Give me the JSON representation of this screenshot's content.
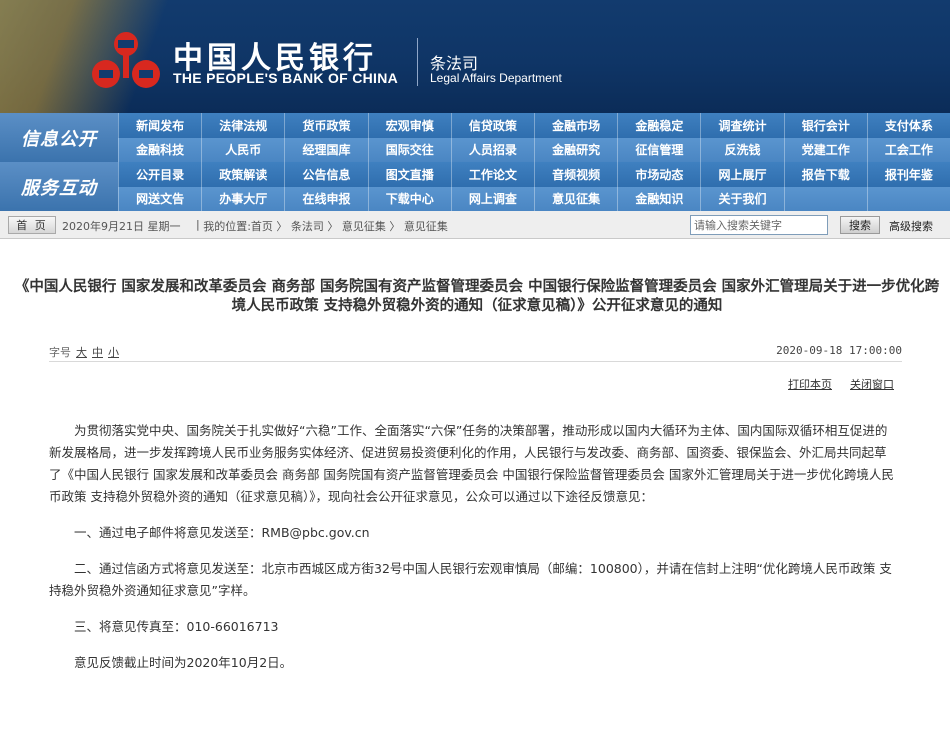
{
  "header": {
    "brand_cn": "中国人民银行",
    "brand_en": "THE PEOPLE'S BANK OF CHINA",
    "dept_cn": "条法司",
    "dept_en": "Legal Affairs Department",
    "logo_icon": "pboc-logo-icon",
    "colors": {
      "banner": "#123b6e",
      "logo_red": "#d32f2f",
      "nav_blue": "#3f80c0"
    }
  },
  "nav": {
    "section1_label": "信息公开",
    "section2_label": "服务互动",
    "rows": [
      [
        "新闻发布",
        "法律法规",
        "货币政策",
        "宏观审慎",
        "信贷政策",
        "金融市场",
        "金融稳定",
        "调查统计",
        "银行会计",
        "支付体系"
      ],
      [
        "金融科技",
        "人民币",
        "经理国库",
        "国际交往",
        "人员招录",
        "金融研究",
        "征信管理",
        "反洗钱",
        "党建工作",
        "工会工作"
      ],
      [
        "公开目录",
        "政策解读",
        "公告信息",
        "图文直播",
        "工作论文",
        "音频视频",
        "市场动态",
        "网上展厅",
        "报告下载",
        "报刊年鉴"
      ],
      [
        "网送文告",
        "办事大厅",
        "在线申报",
        "下载中心",
        "网上调查",
        "意见征集",
        "金融知识",
        "关于我们",
        "",
        ""
      ]
    ]
  },
  "crumbbar": {
    "home": "首 页",
    "date": "2020年9月21日 星期一",
    "location_prefix": "我的位置:",
    "crumbs": [
      "首页",
      "条法司",
      "意见征集",
      "意见征集"
    ],
    "search_placeholder": "请输入搜索关键字",
    "search_button": "搜索",
    "advanced_search": "高级搜索"
  },
  "article": {
    "title": "《中国人民银行 国家发展和改革委员会 商务部 国务院国有资产监督管理委员会 中国银行保险监督管理委员会 国家外汇管理局关于进一步优化跨境人民币政策 支持稳外贸稳外资的通知（征求意见稿）》公开征求意见的通知",
    "fontsize_label": "字号",
    "fontsize_options": [
      "大",
      "中",
      "小"
    ],
    "publish_time": "2020-09-18 17:00:00",
    "print_link": "打印本页",
    "close_link": "关闭窗口",
    "paragraphs": [
      "为贯彻落实党中央、国务院关于扎实做好“六稳”工作、全面落实“六保”任务的决策部署，推动形成以国内大循环为主体、国内国际双循环相互促进的新发展格局，进一步发挥跨境人民币业务服务实体经济、促进贸易投资便利化的作用，人民银行与发改委、商务部、国资委、银保监会、外汇局共同起草了《中国人民银行 国家发展和改革委员会 商务部 国务院国有资产监督管理委员会 中国银行保险监督管理委员会 国家外汇管理局关于进一步优化跨境人民币政策 支持稳外贸稳外资的通知（征求意见稿）》，现向社会公开征求意见，公众可以通过以下途径反馈意见：",
      "一、通过电子邮件将意见发送至：RMB@pbc.gov.cn",
      "二、通过信函方式将意见发送至：北京市西城区成方街32号中国人民银行宏观审慎局（邮编：100800），并请在信封上注明“优化跨境人民币政策 支持稳外贸稳外资通知征求意见”字样。",
      "三、将意见传真至：010-66016713",
      "意见反馈截止时间为2020年10月2日。"
    ]
  }
}
